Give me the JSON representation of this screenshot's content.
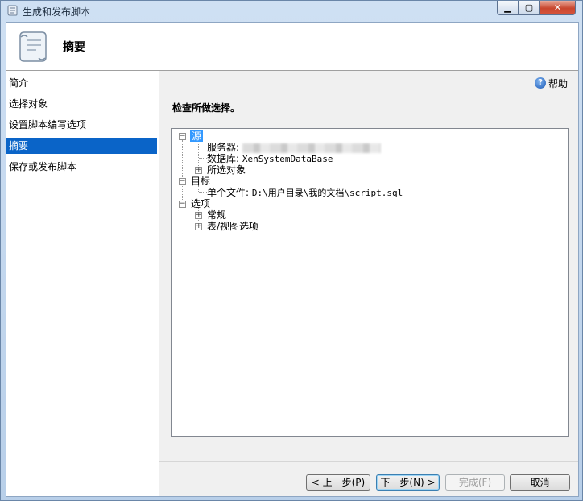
{
  "window": {
    "title": "生成和发布脚本"
  },
  "header": {
    "title": "摘要"
  },
  "sidebar": {
    "items": [
      {
        "label": "简介",
        "active": false
      },
      {
        "label": "选择对象",
        "active": false
      },
      {
        "label": "设置脚本编写选项",
        "active": false
      },
      {
        "label": "摘要",
        "active": true
      },
      {
        "label": "保存或发布脚本",
        "active": false
      }
    ]
  },
  "help": {
    "label": "帮助"
  },
  "main": {
    "section_label": "检查所做选择。"
  },
  "tree": {
    "source": "源",
    "server_label": "服务器:",
    "database_label": "数据库:",
    "database_value": "XenSystemDataBase",
    "selected_objects": "所选对象",
    "target": "目标",
    "single_file_label": "单个文件:",
    "single_file_value": "D:\\用户目录\\我的文档\\script.sql",
    "options": "选项",
    "general": "常规",
    "table_view_options": "表/视图选项"
  },
  "buttons": {
    "previous": "< 上一步(P)",
    "next": "下一步(N) >",
    "finish": "完成(F)",
    "cancel": "取消"
  },
  "colors": {
    "selection": "#0a64c8",
    "tree_highlight": "#3399ff"
  }
}
